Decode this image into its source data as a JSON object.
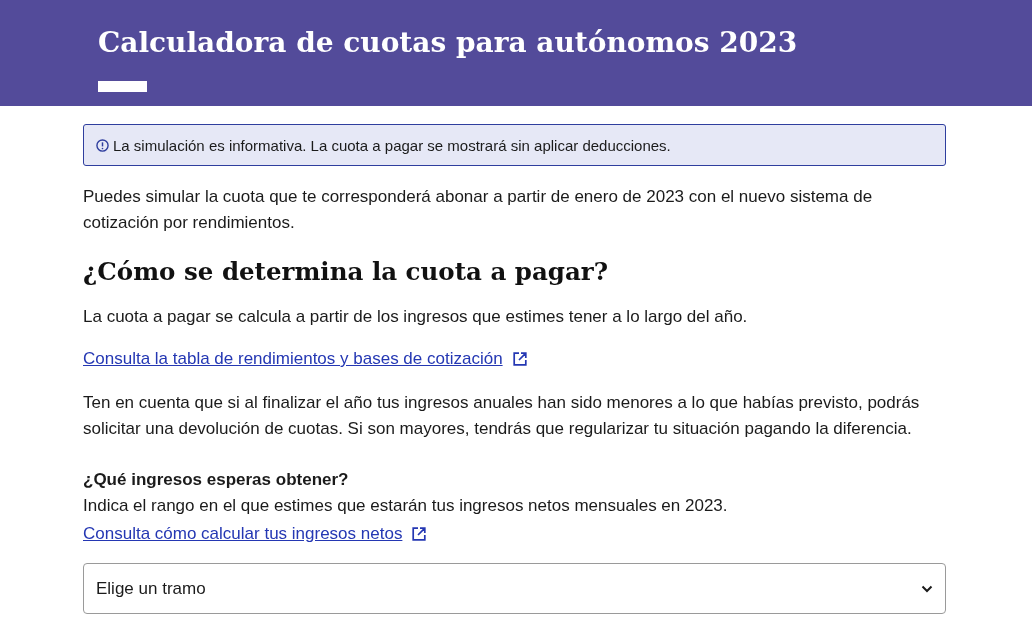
{
  "header": {
    "title": "Calculadora de cuotas para autónomos 2023"
  },
  "notice": {
    "text": "La simulación es informativa. La cuota a pagar se mostrará sin aplicar deducciones."
  },
  "intro": "Puedes simular la cuota que te corresponderá abonar a partir de enero de 2023 con el nuevo sistema de cotización por rendimientos.",
  "section": {
    "heading": "¿Cómo se determina la cuota a pagar?",
    "description": "La cuota a pagar se calcula a partir de los ingresos que estimes tener a lo largo del año.",
    "link": {
      "label": "Consulta la tabla de rendimientos y bases de cotización"
    },
    "note": "Ten en cuenta que si al finalizar el año tus ingresos anuales han sido menores a lo que habías previsto, podrás solicitar una devolución de cuotas. Si son mayores, tendrás que regularizar tu situación pagando la diferencia."
  },
  "income": {
    "question": "¿Qué ingresos esperas obtener?",
    "hint": "Indica el rango en el que estimes que estarán tus ingresos netos mensuales en 2023.",
    "link": {
      "label": "Consulta cómo calcular tus ingresos netos"
    },
    "select": {
      "value": "Elige un tramo"
    }
  }
}
